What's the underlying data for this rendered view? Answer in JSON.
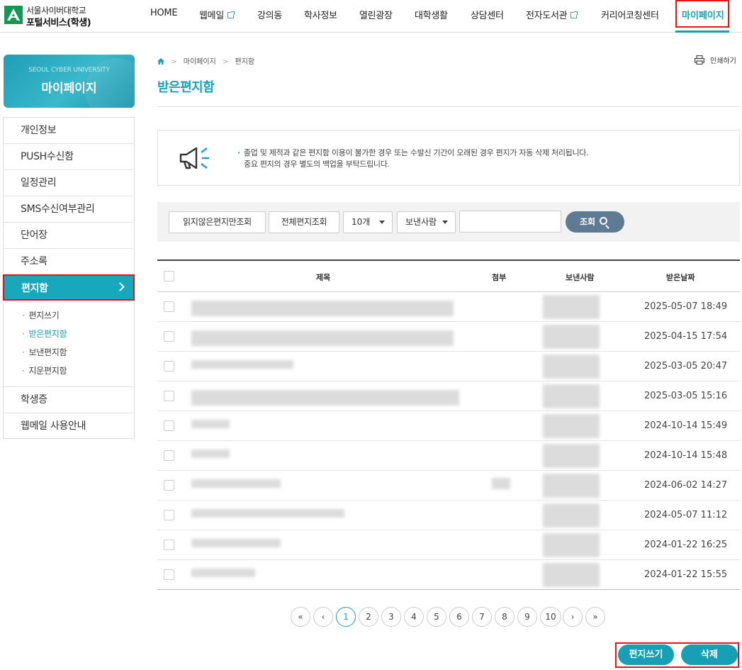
{
  "header": {
    "logo_line1": "서울사이버대학교",
    "logo_line2": "포털서비스(학생)",
    "nav": [
      "HOME",
      "웹메일",
      "강의동",
      "학사정보",
      "열린광장",
      "대학생활",
      "상담센터",
      "전자도서관",
      "커리어코칭센터",
      "마이페이지"
    ],
    "active_nav": "마이페이지"
  },
  "sidebar": {
    "banner_eng": "SEOUL CYBER UNIVERSITY",
    "banner_title": "마이페이지",
    "items": [
      "개인정보",
      "PUSH수신함",
      "일정관리",
      "SMS수신여부관리",
      "단어장",
      "주소록",
      "편지함",
      "학생증",
      "웹메일 사용안내"
    ],
    "active_item": "편지함",
    "sub_items": [
      "편지쓰기",
      "받은편지함",
      "보낸편지함",
      "지운편지함"
    ],
    "current_sub": "받은편지함"
  },
  "breadcrumb": [
    "마이페이지",
    "편지함"
  ],
  "print_label": "인쇄하기",
  "page_title": "받은편지함",
  "notice": {
    "line1": "졸업 및 제적과 같은 편지함 이용이 불가한 경우 또는 수발신 기간이 오래된 경우 편지가 자동 삭제 처리됩니다.",
    "line2": "중요 편지의 경우 별도의 백업을 부탁드립니다."
  },
  "filter": {
    "unread_btn": "읽지않은편지만조회",
    "all_btn": "전체편지조회",
    "count_select": "10개",
    "field_select": "보낸사람",
    "search_value": "",
    "search_btn": "조회"
  },
  "table": {
    "columns": [
      "제목",
      "첨부",
      "보낸사람",
      "받은날짜"
    ],
    "rows": [
      {
        "date": "2025-05-07 18:49"
      },
      {
        "date": "2025-04-15 17:54"
      },
      {
        "date": "2025-03-05 20:47"
      },
      {
        "date": "2025-03-05 15:16"
      },
      {
        "date": "2024-10-14 15:49"
      },
      {
        "date": "2024-10-14 15:48"
      },
      {
        "date": "2024-06-02 14:27"
      },
      {
        "date": "2024-05-07 11:12"
      },
      {
        "date": "2024-01-22 16:25"
      },
      {
        "date": "2024-01-22 15:55"
      }
    ]
  },
  "pagination": {
    "first": "«",
    "prev": "‹",
    "pages": [
      "1",
      "2",
      "3",
      "4",
      "5",
      "6",
      "7",
      "8",
      "9",
      "10"
    ],
    "current": "1",
    "next": "›",
    "last": "»"
  },
  "actions": {
    "write": "편지쓰기",
    "delete": "삭제"
  },
  "colors": {
    "accent": "#17a3b8",
    "highlight_border": "#e11111",
    "search_button": "#5f7a93"
  }
}
